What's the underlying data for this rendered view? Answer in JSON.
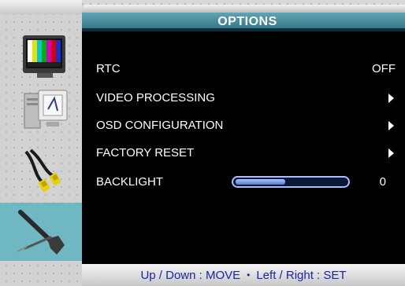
{
  "title": "OPTIONS",
  "menu": [
    {
      "label": "RTC",
      "value": "OFF",
      "has_arrow": false
    },
    {
      "label": "VIDEO PROCESSING",
      "value": "",
      "has_arrow": true
    },
    {
      "label": "OSD CONFIGURATION",
      "value": "",
      "has_arrow": true
    },
    {
      "label": "FACTORY RESET",
      "value": "",
      "has_arrow": true
    },
    {
      "label": "BACKLIGHT",
      "value": "0",
      "has_arrow": false,
      "slider_level": 0.45
    }
  ],
  "sidebar": {
    "items": [
      {
        "icon": "tv-color-bars-icon",
        "active": false
      },
      {
        "icon": "monitor-computer-icon",
        "active": false
      },
      {
        "icon": "av-cables-icon",
        "active": false
      },
      {
        "icon": "wrench-tool-icon",
        "active": true
      }
    ]
  },
  "footer": {
    "nav_hint": "Up / Down : MOVE",
    "separator": "•",
    "set_hint": "Left / Right : SET"
  },
  "colors": {
    "accent": "#4f95a6",
    "active_tab": "#6fb7c3",
    "footer_text": "#1c24a8",
    "slider": "#aebcff"
  }
}
